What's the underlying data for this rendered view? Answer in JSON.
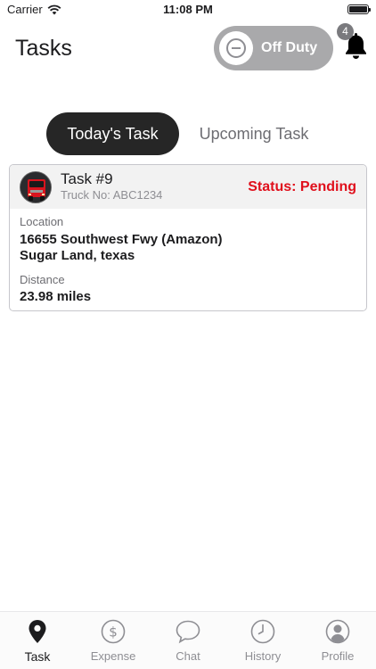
{
  "status_bar": {
    "carrier": "Carrier",
    "time": "11:08 PM",
    "icons": [
      "wifi-icon",
      "battery-icon"
    ]
  },
  "header": {
    "title": "Tasks",
    "duty_toggle": {
      "label": "Off Duty",
      "state": "off",
      "icon": "minus-circle-icon"
    },
    "notifications": {
      "count": "4",
      "icon": "bell-icon"
    }
  },
  "tabs": [
    {
      "label": "Today's Task",
      "active": true
    },
    {
      "label": "Upcoming Task",
      "active": false
    }
  ],
  "task": {
    "title": "Task #9",
    "truck_no": "Truck No: ABC1234",
    "status": "Status: Pending",
    "location_label": "Location",
    "address_line1": "16655 Southwest Fwy (Amazon)",
    "address_line2": "Sugar Land, texas",
    "distance_label": "Distance",
    "distance": "23.98 miles"
  },
  "tab_bar": {
    "items": [
      {
        "label": "Task",
        "icon": "map-pin-icon",
        "active": true
      },
      {
        "label": "Expense",
        "icon": "dollar-circle-icon",
        "active": false
      },
      {
        "label": "Chat",
        "icon": "chat-bubble-icon",
        "active": false
      },
      {
        "label": "History",
        "icon": "clock-icon",
        "active": false
      },
      {
        "label": "Profile",
        "icon": "person-circle-icon",
        "active": false
      }
    ]
  },
  "colors": {
    "status_pending": "#e0101c",
    "active_tab_bg": "#262626",
    "toggle_bg": "#a9a9ab"
  }
}
